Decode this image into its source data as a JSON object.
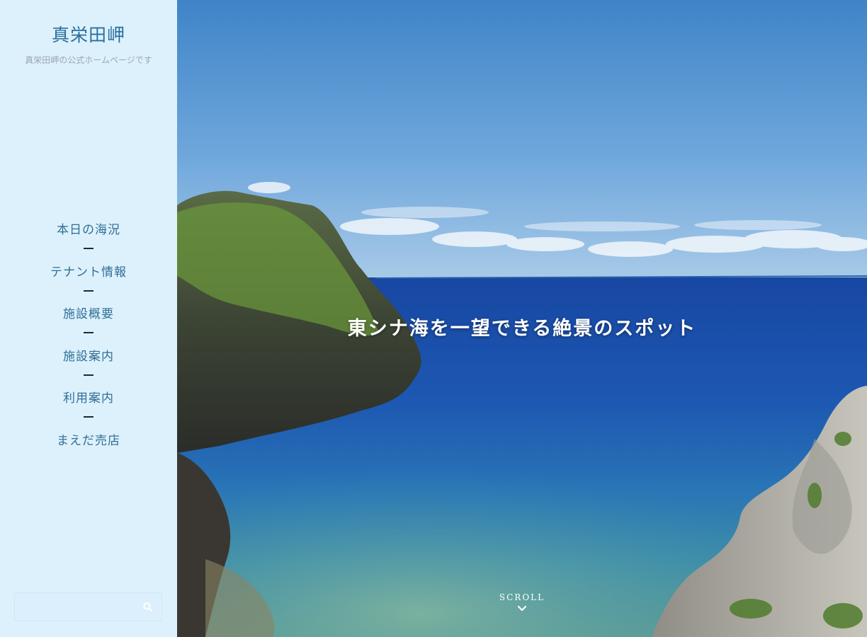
{
  "site": {
    "title": "真栄田岬",
    "tagline": "真栄田岬の公式ホームページです"
  },
  "nav": {
    "items": [
      {
        "label": "本日の海況"
      },
      {
        "label": "テナント情報"
      },
      {
        "label": "施設概要"
      },
      {
        "label": "施設案内"
      },
      {
        "label": "利用案内"
      },
      {
        "label": "まえだ売店"
      }
    ]
  },
  "search": {
    "placeholder": "",
    "value": "",
    "icon": "search-icon"
  },
  "hero": {
    "heading": "東シナ海を一望できる絶景のスポット",
    "scroll_label": "SCROLL",
    "scroll_icon": "chevron-down-icon"
  },
  "colors": {
    "sidebar_bg": "#ddf1fd",
    "title": "#2a6f9e",
    "nav_text": "#2f6f95",
    "sky": "#4e92d2",
    "sea": "#1f57b0"
  }
}
